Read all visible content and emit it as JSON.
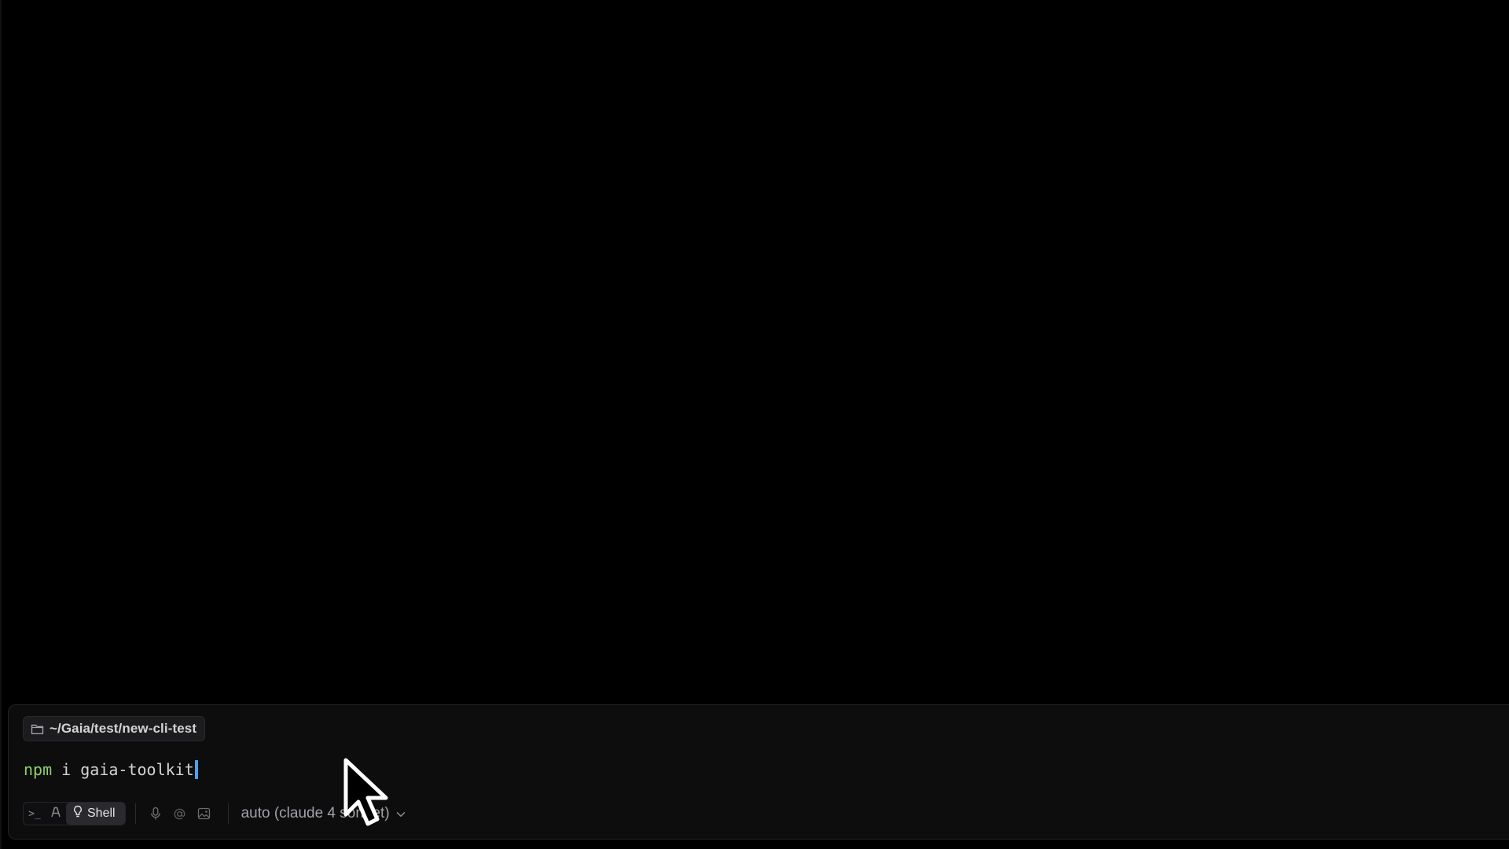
{
  "input_panel": {
    "directory": "~/Gaia/test/new-cli-test",
    "command": {
      "program": "npm",
      "args": " i gaia-toolkit"
    }
  },
  "toolbar": {
    "terminal_mode_glyph": ">_",
    "agent_mode_icon": "agent-icon",
    "shell_label": "Shell",
    "mic_icon": "mic-icon",
    "mention_icon": "at-sign-icon",
    "image_icon": "image-icon",
    "model_label": "auto (claude 4 sonnet)"
  },
  "colors": {
    "command_program": "#8fcf6a",
    "caret": "#4aa3f0",
    "panel_background": "#0d0d0e"
  }
}
